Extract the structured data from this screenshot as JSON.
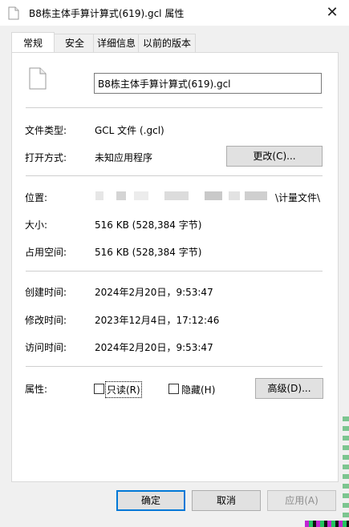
{
  "window": {
    "title": "B8栋主体手算计算式(619).gcl 属性",
    "close_glyph": "✕"
  },
  "tabs": [
    {
      "label": "常规"
    },
    {
      "label": "安全"
    },
    {
      "label": "详细信息"
    },
    {
      "label": "以前的版本"
    }
  ],
  "general": {
    "file_name": "B8栋主体手算计算式(619).gcl",
    "file_type_label": "文件类型:",
    "file_type_value": "GCL 文件 (.gcl)",
    "opens_with_label": "打开方式:",
    "opens_with_value": "未知应用程序",
    "change_button": "更改(C)...",
    "location_label": "位置:",
    "location_value_visible": "\\计量文件\\",
    "size_label": "大小:",
    "size_value": "516 KB (528,384 字节)",
    "size_on_disk_label": "占用空间:",
    "size_on_disk_value": "516 KB (528,384 字节)",
    "created_label": "创建时间:",
    "created_value": "2024年2月20日，9:53:47",
    "modified_label": "修改时间:",
    "modified_value": "2023年12月4日，17:12:46",
    "accessed_label": "访问时间:",
    "accessed_value": "2024年2月20日，9:53:47",
    "attributes_label": "属性:",
    "readonly_label": "只读(R)",
    "readonly_checked": false,
    "hidden_label": "隐藏(H)",
    "hidden_checked": false,
    "advanced_button": "高级(D)..."
  },
  "footer": {
    "ok": "确定",
    "cancel": "取消",
    "apply": "应用(A)"
  },
  "colors": {
    "accent": "#0078d7",
    "panel_bg": "#ffffff",
    "window_bg": "#f0f0f0"
  },
  "icons": {
    "title": "document-icon",
    "file": "document-icon",
    "close": "close-icon"
  }
}
